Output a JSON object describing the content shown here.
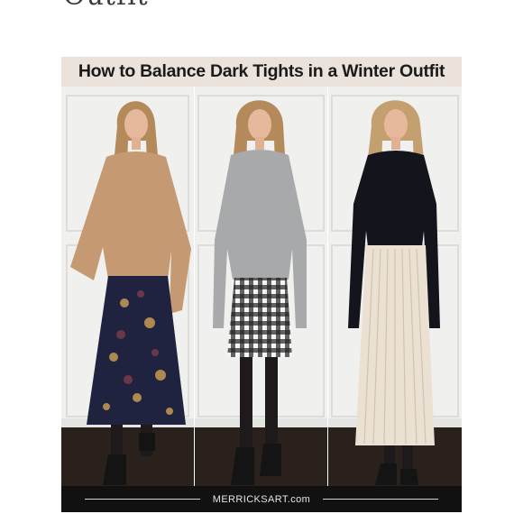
{
  "page": {
    "cut_title": "Outfit"
  },
  "pin": {
    "title": "How to Balance Dark Tights in a Winter Outfit",
    "brand": "MERRICKSART.com"
  },
  "photos": [
    {
      "outfit": "tan sweater, floral midi skirt, black tights, black ankle boots"
    },
    {
      "outfit": "gray sweater, gingham pencil skirt, black tights, black ankle boots"
    },
    {
      "outfit": "black ruffle top, cream pleated midi skirt, black tights, black ankle boots"
    }
  ],
  "colors": {
    "title_band": "#ece2dc",
    "footer": "#111111",
    "wall": "#f1f1ef",
    "floor": "#2b211c"
  }
}
